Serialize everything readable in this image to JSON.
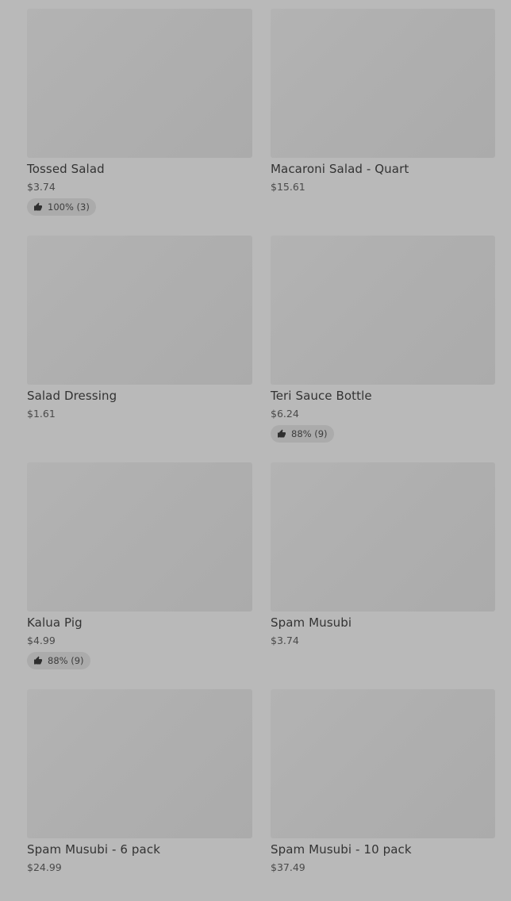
{
  "items": [
    {
      "name": "Tossed Salad",
      "price": "$3.74",
      "rating": "100% (3)"
    },
    {
      "name": "Macaroni Salad - Quart",
      "price": "$15.61"
    },
    {
      "name": "Salad Dressing",
      "price": "$1.61"
    },
    {
      "name": "Teri Sauce Bottle",
      "price": "$6.24",
      "rating": "88% (9)"
    },
    {
      "name": "Kalua Pig",
      "price": "$4.99",
      "rating": "88% (9)"
    },
    {
      "name": "Spam Musubi",
      "price": "$3.74"
    },
    {
      "name": "Spam Musubi - 6 pack",
      "price": "$24.99"
    },
    {
      "name": "Spam Musubi - 10 pack",
      "price": "$37.49"
    }
  ],
  "icons": {
    "rating": "thumbs-up-icon"
  }
}
